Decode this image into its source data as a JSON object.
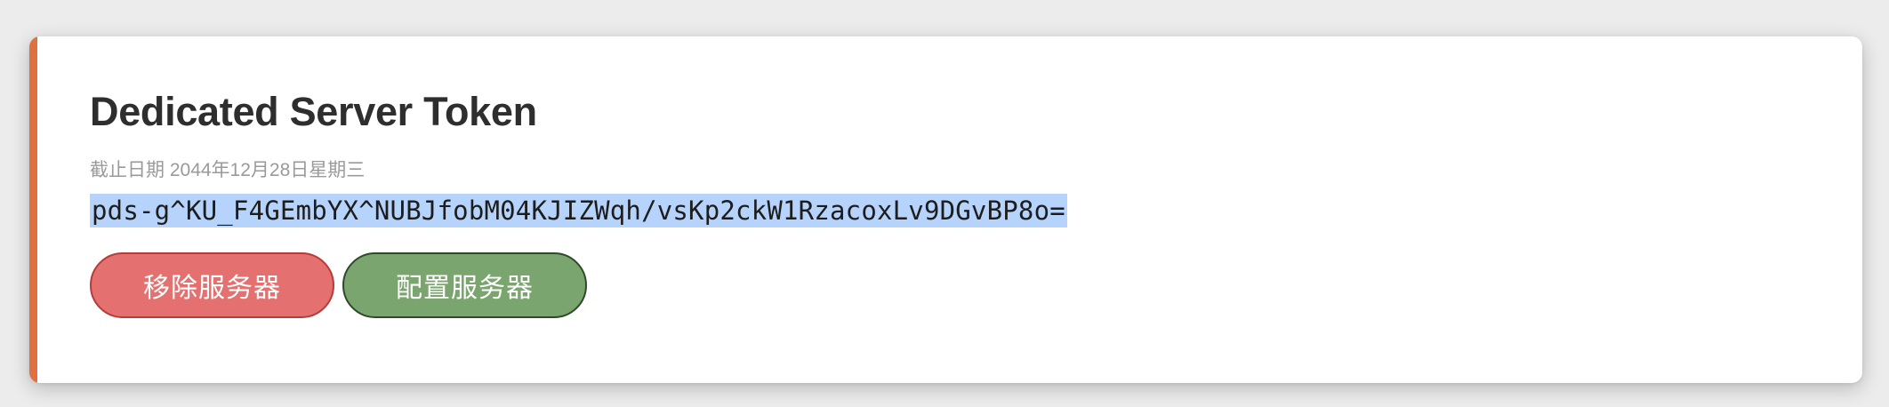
{
  "card": {
    "title": "Dedicated Server Token",
    "expiry_text": "截止日期 2044年12月28日星期三",
    "token": "pds-g^KU_F4GEmbYX^NUBJfobM04KJIZWqh/vsKp2ckW1RzacoxLv9DGvBP8o=",
    "accent_color": "#e07040",
    "buttons": {
      "remove_label": "移除服务器",
      "configure_label": "配置服务器"
    }
  },
  "colors": {
    "remove_button": "#e4716f",
    "configure_button": "#7aa56e",
    "selection_highlight": "#b6d3fb"
  }
}
